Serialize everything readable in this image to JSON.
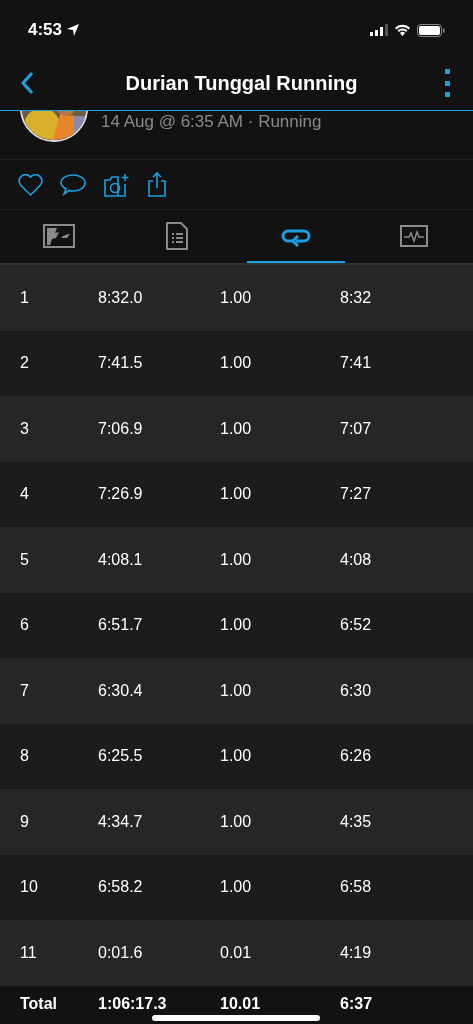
{
  "status_bar": {
    "time": "4:53"
  },
  "nav": {
    "title": "Durian Tunggal Running"
  },
  "activity": {
    "subtitle": "14 Aug @ 6:35 AM · Running"
  },
  "tabs": [
    {
      "kind": "map",
      "selected": false
    },
    {
      "kind": "details",
      "selected": false
    },
    {
      "kind": "laps",
      "selected": true
    },
    {
      "kind": "charts",
      "selected": false
    }
  ],
  "laps": {
    "rows": [
      {
        "cells": [
          "1",
          "8:32.0",
          "1.00",
          "8:32"
        ]
      },
      {
        "cells": [
          "2",
          "7:41.5",
          "1.00",
          "7:41"
        ]
      },
      {
        "cells": [
          "3",
          "7:06.9",
          "1.00",
          "7:07"
        ]
      },
      {
        "cells": [
          "4",
          "7:26.9",
          "1.00",
          "7:27"
        ]
      },
      {
        "cells": [
          "5",
          "4:08.1",
          "1.00",
          "4:08"
        ]
      },
      {
        "cells": [
          "6",
          "6:51.7",
          "1.00",
          "6:52"
        ]
      },
      {
        "cells": [
          "7",
          "6:30.4",
          "1.00",
          "6:30"
        ]
      },
      {
        "cells": [
          "8",
          "6:25.5",
          "1.00",
          "6:26"
        ]
      },
      {
        "cells": [
          "9",
          "4:34.7",
          "1.00",
          "4:35"
        ]
      },
      {
        "cells": [
          "10",
          "6:58.2",
          "1.00",
          "6:58"
        ]
      },
      {
        "cells": [
          "11",
          "0:01.6",
          "0.01",
          "4:19"
        ]
      }
    ],
    "total": [
      "Total",
      "1:06:17.3",
      "10.01",
      "6:37"
    ]
  }
}
